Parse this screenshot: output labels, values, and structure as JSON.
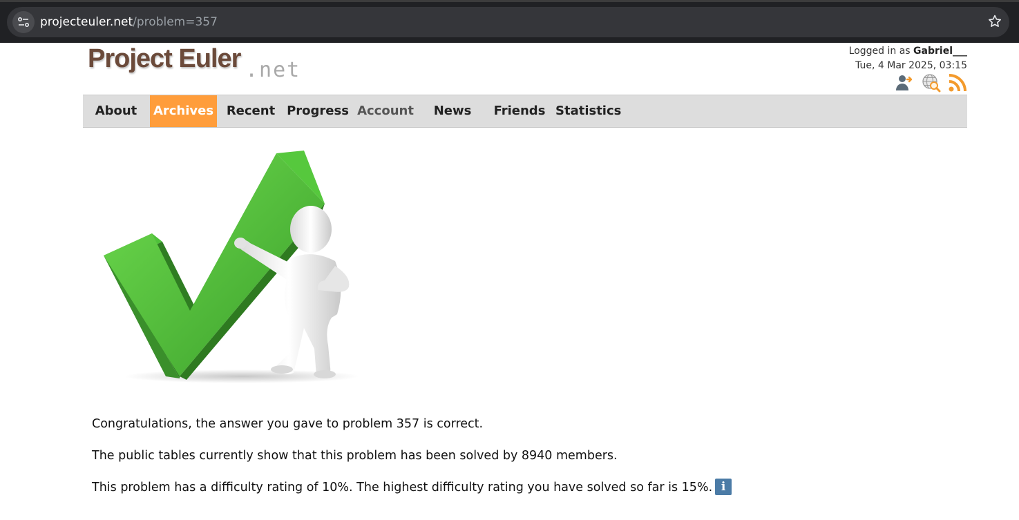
{
  "browser": {
    "url_host": "projecteuler.net",
    "url_path": "/problem=357"
  },
  "header": {
    "logo_main": "Project Euler",
    "logo_net": ".net",
    "logged_in_prefix": "Logged in as ",
    "username": "Gabriel___",
    "datetime": "Tue, 4 Mar 2025, 03:15",
    "icons": [
      "account-switch-icon",
      "search-globe-icon",
      "rss-feed-icon"
    ]
  },
  "nav": {
    "items": [
      {
        "label": "About"
      },
      {
        "label": "Archives",
        "active": true
      },
      {
        "label": "Recent"
      },
      {
        "label": "Progress"
      },
      {
        "label": "Account"
      },
      {
        "label": "News"
      },
      {
        "label": "Friends"
      },
      {
        "label": "Statistics"
      }
    ],
    "active_color": "#ff9d3b"
  },
  "illustration": "checkmark-figure",
  "messages": {
    "line1": "Congratulations, the answer you gave to problem 357 is correct.",
    "line2": "The public tables currently show that this problem has been solved by 8940 members.",
    "line3": "This problem has a difficulty rating of 10%. The highest difficulty rating you have solved so far is 15%.",
    "info_glyph": "i"
  }
}
